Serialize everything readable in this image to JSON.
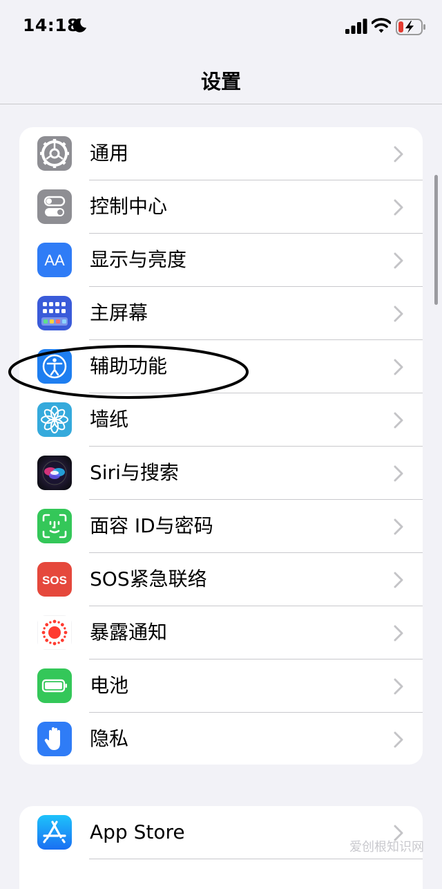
{
  "status_bar": {
    "time": "14:18",
    "icons": [
      "moon-icon",
      "cellular-signal-icon",
      "wifi-icon",
      "battery-charging-icon"
    ]
  },
  "nav": {
    "title": "设置"
  },
  "groups": [
    {
      "items": [
        {
          "label": "通用",
          "icon": "gear-icon",
          "color": "#8e8e93"
        },
        {
          "label": "控制中心",
          "icon": "toggle-switches-icon",
          "color": "#8e8e93"
        },
        {
          "label": "显示与亮度",
          "icon": "text-size-aa-icon",
          "color": "#2f7cf6"
        },
        {
          "label": "主屏幕",
          "icon": "home-screen-grid-icon",
          "color": "#3a5bd9"
        },
        {
          "label": "辅助功能",
          "icon": "accessibility-person-icon",
          "color": "#1e7ef0"
        },
        {
          "label": "墙纸",
          "icon": "flower-icon",
          "color": "#35aadc"
        },
        {
          "label": "Siri与搜索",
          "icon": "siri-orb-icon",
          "color": "#1a1a2e"
        },
        {
          "label": "面容 ID与密码",
          "icon": "face-id-icon",
          "color": "#34c759"
        },
        {
          "label": "SOS紧急联络",
          "icon": "sos-icon",
          "color": "#e5483c"
        },
        {
          "label": "暴露通知",
          "icon": "exposure-notification-icon",
          "color": "#ff3b30"
        },
        {
          "label": "电池",
          "icon": "battery-icon",
          "color": "#34c759"
        },
        {
          "label": "隐私",
          "icon": "hand-icon",
          "color": "#2f7cf6"
        }
      ]
    },
    {
      "items": [
        {
          "label": "App Store",
          "icon": "app-store-icon",
          "color": "#1c8cf5"
        }
      ]
    }
  ],
  "annotation": {
    "type": "ellipse-highlight",
    "target": "辅助功能",
    "color": "#000000"
  },
  "watermark": "爱创根知识网"
}
